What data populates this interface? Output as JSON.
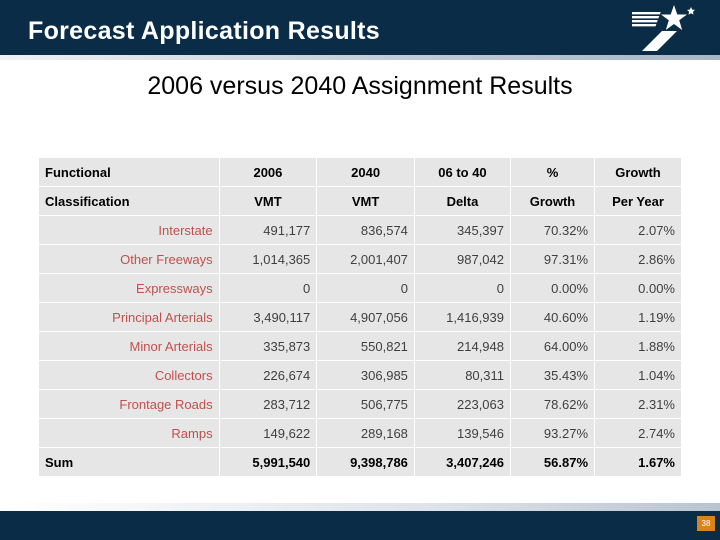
{
  "header": {
    "title": "Forecast Application Results",
    "logo_icon": "txdot-star-t-logo"
  },
  "subtitle": "2006 versus 2040 Assignment Results",
  "footer": {
    "page_number": "38"
  },
  "table": {
    "header_row_1": [
      "Functional",
      "2006",
      "2040",
      "06 to 40",
      "%",
      "Growth"
    ],
    "header_row_2": [
      "Classification",
      "VMT",
      "VMT",
      "Delta",
      "Growth",
      "Per Year"
    ],
    "rows": [
      {
        "label": "Interstate",
        "vmt_2006": "491,177",
        "vmt_2040": "836,574",
        "delta": "345,397",
        "growth_pct": "70.32%",
        "growth_per_year": "2.07%"
      },
      {
        "label": "Other Freeways",
        "vmt_2006": "1,014,365",
        "vmt_2040": "2,001,407",
        "delta": "987,042",
        "growth_pct": "97.31%",
        "growth_per_year": "2.86%"
      },
      {
        "label": "Expressways",
        "vmt_2006": "0",
        "vmt_2040": "0",
        "delta": "0",
        "growth_pct": "0.00%",
        "growth_per_year": "0.00%"
      },
      {
        "label": "Principal Arterials",
        "vmt_2006": "3,490,117",
        "vmt_2040": "4,907,056",
        "delta": "1,416,939",
        "growth_pct": "40.60%",
        "growth_per_year": "1.19%"
      },
      {
        "label": "Minor Arterials",
        "vmt_2006": "335,873",
        "vmt_2040": "550,821",
        "delta": "214,948",
        "growth_pct": "64.00%",
        "growth_per_year": "1.88%"
      },
      {
        "label": "Collectors",
        "vmt_2006": "226,674",
        "vmt_2040": "306,985",
        "delta": "80,311",
        "growth_pct": "35.43%",
        "growth_per_year": "1.04%"
      },
      {
        "label": "Frontage Roads",
        "vmt_2006": "283,712",
        "vmt_2040": "506,775",
        "delta": "223,063",
        "growth_pct": "78.62%",
        "growth_per_year": "2.31%"
      },
      {
        "label": "Ramps",
        "vmt_2006": "149,622",
        "vmt_2040": "289,168",
        "delta": "139,546",
        "growth_pct": "93.27%",
        "growth_per_year": "2.74%"
      }
    ],
    "sum_row": {
      "label": "Sum",
      "vmt_2006": "5,991,540",
      "vmt_2040": "9,398,786",
      "delta": "3,407,246",
      "growth_pct": "56.87%",
      "growth_per_year": "1.67%"
    }
  },
  "colors": {
    "header_navy": "#0b2c47",
    "row_label_red": "#c0504d",
    "cell_gray": "#e6e6e6",
    "badge_orange": "#d98318"
  }
}
